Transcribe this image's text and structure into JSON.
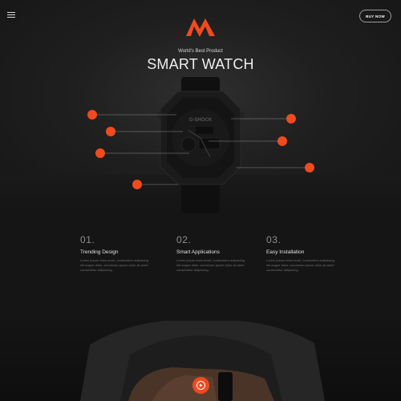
{
  "header": {
    "buy_label": "BUY NOW"
  },
  "hero": {
    "subtitle": "World's Best Product",
    "title": "SMART WATCH",
    "watch_brand": "G-SHOCK"
  },
  "features": [
    {
      "number": "01.",
      "title": "Trending Design",
      "text": "Lorem ipsum dolor amet, consectetur adipiscing elit augue diam, accumsan ipsum dolor sit amet consectetur adipiscing."
    },
    {
      "number": "02.",
      "title": "Smart Applications",
      "text": "Lorem ipsum dolor amet, consectetur adipiscing elit augue diam, accumsan ipsum dolor sit amet consectetur adipiscing."
    },
    {
      "number": "03.",
      "title": "Easy Installation",
      "text": "Lorem ipsum dolor amet, consectetur adipiscing elit augue diam, accumsan ipsum dolor sit amet consectetur adipiscing."
    }
  ],
  "colors": {
    "accent": "#f04a1f",
    "background": "#171717"
  },
  "icons": {
    "menu": "hamburger-menu-icon",
    "logo": "brand-logo-icon",
    "play": "play-icon"
  }
}
